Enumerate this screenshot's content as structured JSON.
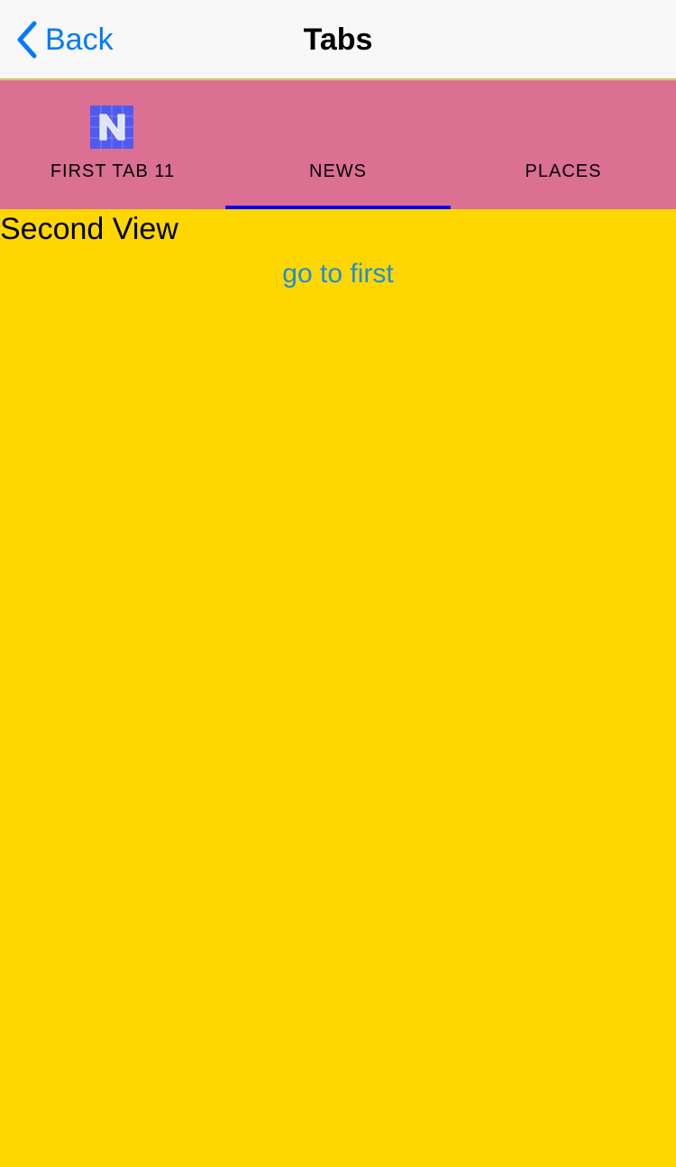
{
  "nav_bar": {
    "back_label": "Back",
    "title": "Tabs",
    "back_icon": "chevron-left-icon"
  },
  "tabs": [
    {
      "label": "FIRST TAB 11",
      "icon": "nativescript-logo-icon",
      "selected": false
    },
    {
      "label": "NEWS",
      "selected": true
    },
    {
      "label": "PLACES",
      "selected": false
    }
  ],
  "content": {
    "heading": "Second View",
    "link_label": "go to first"
  },
  "colors": {
    "nav_background": "#F8F8F8",
    "accent": "#007AFF",
    "tab_strip_background": "#DB7093",
    "tab_indicator": "#0000FF",
    "content_background": "#FFD700",
    "link": "#1F8FD2"
  }
}
